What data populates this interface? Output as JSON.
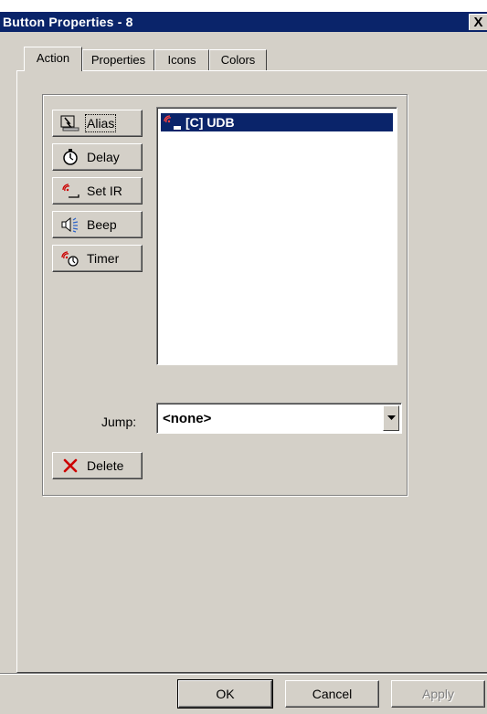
{
  "window": {
    "title": "Button Properties - 8",
    "close_glyph": "X"
  },
  "tabs": [
    {
      "label": "Action",
      "active": true
    },
    {
      "label": "Properties",
      "active": false
    },
    {
      "label": "Icons",
      "active": false
    },
    {
      "label": "Colors",
      "active": false
    }
  ],
  "actions": [
    {
      "label": "Alias",
      "icon": "alias-icon"
    },
    {
      "label": "Delay",
      "icon": "stopwatch-icon"
    },
    {
      "label": "Set IR",
      "icon": "ir-signal-icon"
    },
    {
      "label": "Beep",
      "icon": "speaker-icon"
    },
    {
      "label": "Timer",
      "icon": "ir-timer-icon"
    }
  ],
  "list": {
    "items": [
      {
        "label": "[C] UDB",
        "selected": true,
        "icon": "ir-signal-icon"
      }
    ]
  },
  "jump": {
    "label": "Jump:",
    "value": "<none>"
  },
  "delete_button": {
    "label": "Delete",
    "icon": "delete-x-icon"
  },
  "footer": {
    "ok": "OK",
    "cancel": "Cancel",
    "apply": "Apply"
  },
  "colors": {
    "title_bar": "#0a246a",
    "face": "#d4d0c8",
    "selection": "#0a246a",
    "delete_x": "#cc0000",
    "ir_red": "#cc0000"
  }
}
